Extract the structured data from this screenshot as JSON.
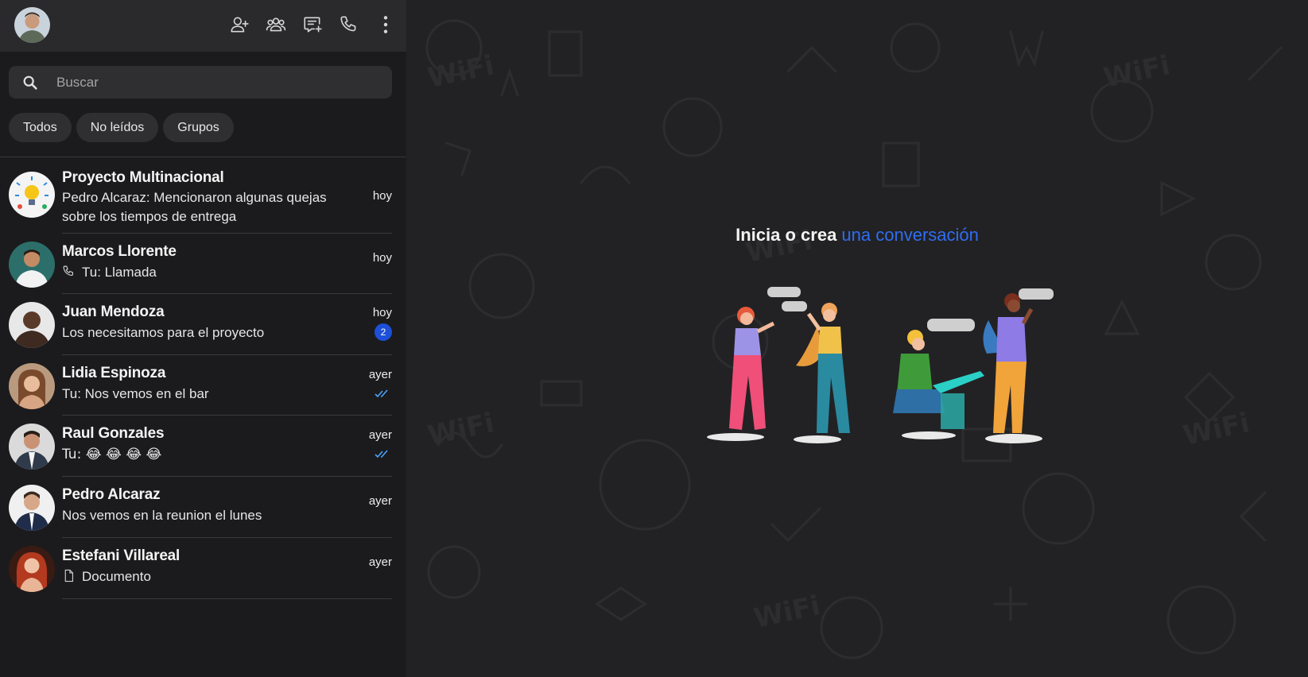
{
  "sidebar": {
    "header": {
      "icons": [
        "add-contact-icon",
        "groups-icon",
        "new-chat-icon",
        "call-icon",
        "more-vertical-icon"
      ]
    },
    "search": {
      "placeholder": "Buscar"
    },
    "filters": [
      "Todos",
      "No leídos",
      "Grupos"
    ],
    "chats": [
      {
        "name": "Proyecto Multinacional",
        "preview": "Pedro Alcaraz: Mencionaron algunas quejas sobre los tiempos de entrega",
        "time": "hoy",
        "avatar": "lightbulb-group-avatar"
      },
      {
        "name": "Marcos Llorente",
        "preview": "Tu: Llamada",
        "time": "hoy",
        "preview_icon": "phone-icon"
      },
      {
        "name": "Juan Mendoza",
        "preview": "Los necesitamos para el proyecto",
        "time": "hoy",
        "unread": "2"
      },
      {
        "name": "Lidia Espinoza",
        "preview": "Tu: Nos vemos en el bar",
        "time": "ayer",
        "status": "read-ticks-icon"
      },
      {
        "name": "Raul Gonzales",
        "preview": "Tu: 😂 😂 😂 😂",
        "time": "ayer",
        "status": "read-ticks-icon"
      },
      {
        "name": "Pedro Alcaraz",
        "preview": "Nos vemos en la reunion el lunes",
        "time": "ayer"
      },
      {
        "name": "Estefani Villareal",
        "preview": "Documento",
        "time": "ayer",
        "preview_icon": "document-icon"
      }
    ]
  },
  "main": {
    "headline_start": "Inicia o crea ",
    "headline_accent": "una conversación"
  },
  "colors": {
    "accent": "#2f6df2",
    "badge": "#1d4fd8",
    "read_ticks": "#4aa3ff",
    "sidebar_bg": "#1b1b1d",
    "main_bg": "#222224"
  }
}
